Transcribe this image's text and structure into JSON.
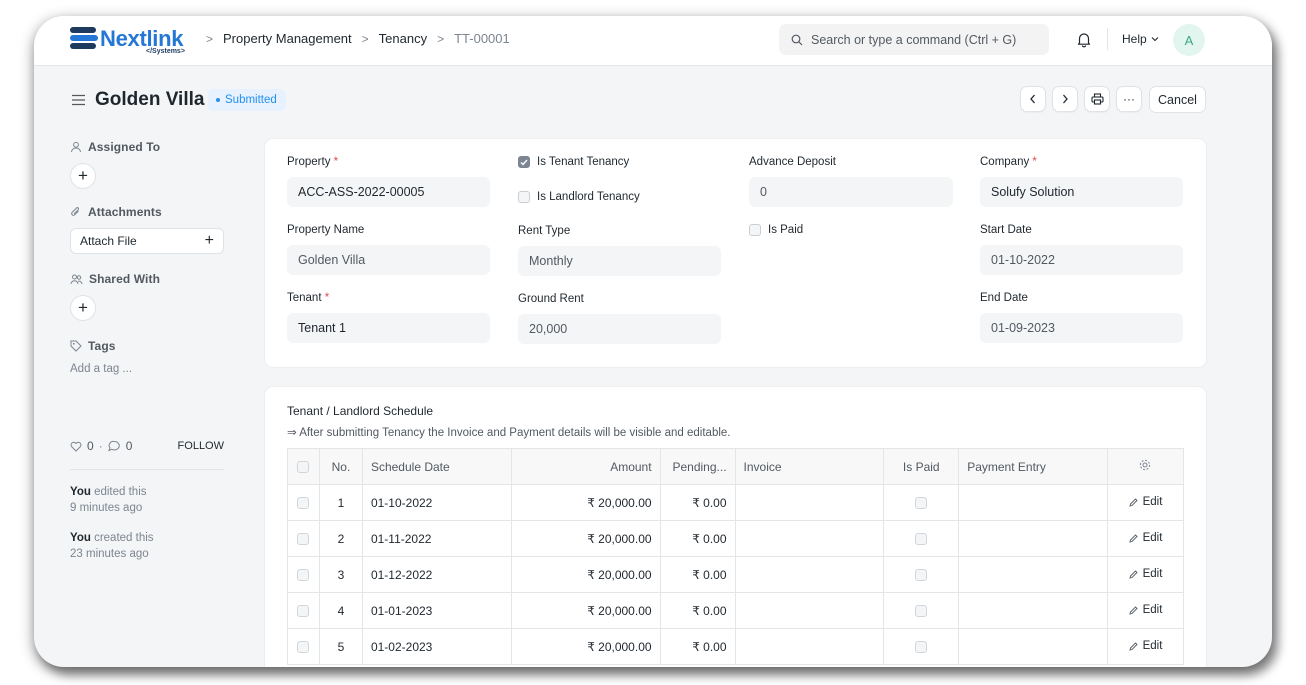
{
  "app": {
    "logo_text": "Nextlink",
    "logo_subtext": "</Systems>",
    "accent_color": "#2490ef"
  },
  "breadcrumb": [
    "Property Management",
    "Tenancy",
    "TT-00001"
  ],
  "search": {
    "placeholder": "Search or type a command (Ctrl + G)"
  },
  "navbar": {
    "help_label": "Help",
    "avatar_initial": "A"
  },
  "page": {
    "title": "Golden Villa",
    "status": "Submitted",
    "actions": {
      "more": "···",
      "cancel": "Cancel"
    }
  },
  "sidebar": {
    "assigned_to": "Assigned To",
    "attachments": "Attachments",
    "attach_file": "Attach File",
    "shared_with": "Shared With",
    "tags": "Tags",
    "add_tag": "Add a tag ...",
    "likes": "0",
    "comments": "0",
    "follow": "FOLLOW",
    "activity": [
      {
        "who": "You",
        "what": "edited this",
        "when": "9 minutes ago"
      },
      {
        "who": "You",
        "what": "created this",
        "when": "23 minutes ago"
      }
    ]
  },
  "form": {
    "property": {
      "label": "Property",
      "value": "ACC-ASS-2022-00005"
    },
    "property_name": {
      "label": "Property Name",
      "value": "Golden Villa"
    },
    "tenant": {
      "label": "Tenant",
      "value": "Tenant 1"
    },
    "is_tenant_tenancy": {
      "label": "Is Tenant Tenancy",
      "checked": true
    },
    "is_landlord_tenancy": {
      "label": "Is Landlord Tenancy",
      "checked": false
    },
    "rent_type": {
      "label": "Rent Type",
      "value": "Monthly"
    },
    "ground_rent": {
      "label": "Ground Rent",
      "value": "20,000"
    },
    "advance_deposit": {
      "label": "Advance Deposit",
      "value": "0"
    },
    "is_paid": {
      "label": "Is Paid",
      "checked": false
    },
    "company": {
      "label": "Company",
      "value": "Solufy Solution"
    },
    "start_date": {
      "label": "Start Date",
      "value": "01-10-2022"
    },
    "end_date": {
      "label": "End Date",
      "value": "01-09-2023"
    }
  },
  "schedule": {
    "title": "Tenant / Landlord Schedule",
    "note": "⇒ After submitting Tenancy the Invoice and Payment details will be visible and editable.",
    "columns": [
      "No.",
      "Schedule Date",
      "Amount",
      "Pending...",
      "Invoice",
      "Is Paid",
      "Payment Entry"
    ],
    "edit_label": "Edit",
    "rows": [
      {
        "no": "1",
        "date": "01-10-2022",
        "amount": "₹ 20,000.00",
        "pending": "₹ 0.00",
        "invoice": "",
        "payment_entry": ""
      },
      {
        "no": "2",
        "date": "01-11-2022",
        "amount": "₹ 20,000.00",
        "pending": "₹ 0.00",
        "invoice": "",
        "payment_entry": ""
      },
      {
        "no": "3",
        "date": "01-12-2022",
        "amount": "₹ 20,000.00",
        "pending": "₹ 0.00",
        "invoice": "",
        "payment_entry": ""
      },
      {
        "no": "4",
        "date": "01-01-2023",
        "amount": "₹ 20,000.00",
        "pending": "₹ 0.00",
        "invoice": "",
        "payment_entry": ""
      },
      {
        "no": "5",
        "date": "01-02-2023",
        "amount": "₹ 20,000.00",
        "pending": "₹ 0.00",
        "invoice": "",
        "payment_entry": ""
      }
    ]
  }
}
